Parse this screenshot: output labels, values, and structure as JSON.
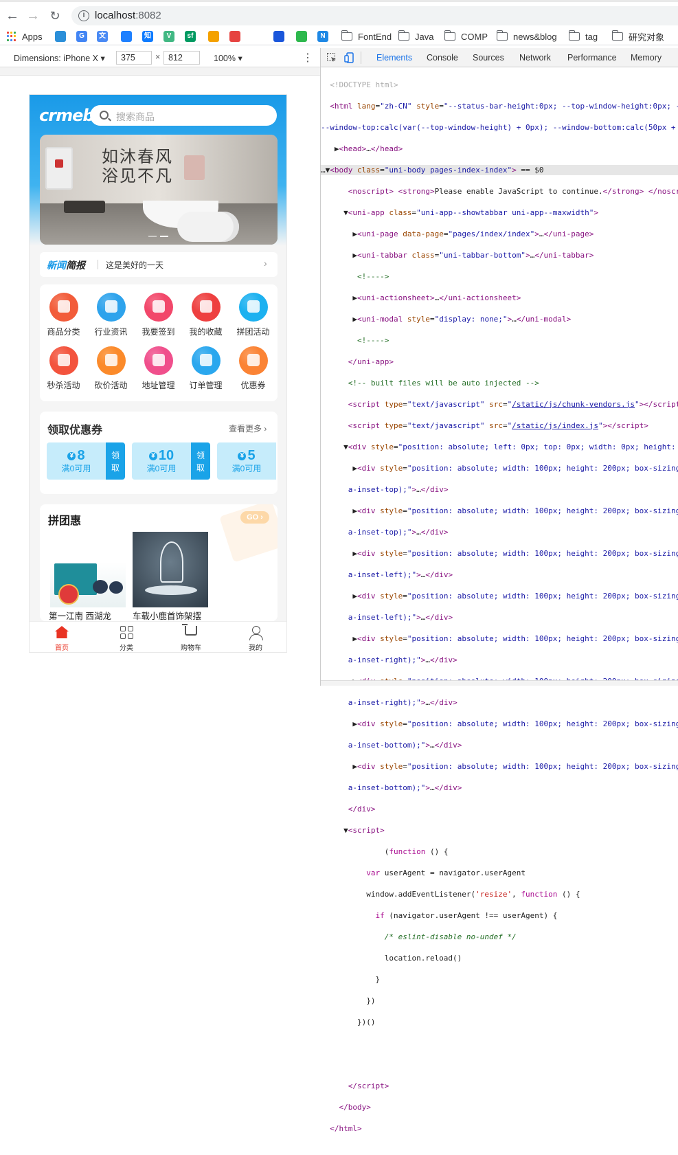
{
  "browser": {
    "url_host": "localhost",
    "url_port": ":8082",
    "bookmarks": [
      {
        "label": "Apps",
        "type": "apps"
      },
      {
        "label": "",
        "type": "site",
        "color": "#2b8fd9"
      },
      {
        "label": "",
        "type": "site",
        "color": "#4285f4",
        "glyph": "G"
      },
      {
        "label": "",
        "type": "site",
        "color": "#4a8af4",
        "glyph": "文"
      },
      {
        "label": "",
        "type": "site",
        "color": "#1e80ff"
      },
      {
        "label": "",
        "type": "site",
        "color": "#0e7bff",
        "glyph": "知"
      },
      {
        "label": "",
        "type": "site",
        "color": "#41b883",
        "glyph": "V"
      },
      {
        "label": "",
        "type": "site",
        "color": "#009a61",
        "glyph": "sf"
      },
      {
        "label": "",
        "type": "site",
        "color": "#f4a100"
      },
      {
        "label": "",
        "type": "site",
        "color": "#e64340"
      },
      {
        "label": "",
        "type": "site",
        "color": "#1a56db"
      },
      {
        "label": "",
        "type": "site",
        "color": "#2db84d"
      },
      {
        "label": "",
        "type": "site",
        "color": "#1e88e5",
        "glyph": "N"
      },
      {
        "label": "FontEnd",
        "type": "folder"
      },
      {
        "label": "Java",
        "type": "folder"
      },
      {
        "label": "COMP",
        "type": "folder"
      },
      {
        "label": "news&blog",
        "type": "folder"
      },
      {
        "label": "tag",
        "type": "folder"
      },
      {
        "label": "研究对象",
        "type": "folder"
      }
    ]
  },
  "device_toolbar": {
    "device": "Dimensions: iPhone X ▾",
    "width": "375",
    "height": "812",
    "times": "×",
    "zoom": "100% ▾",
    "more": "⋮"
  },
  "page": {
    "logo": "crmeb",
    "search_placeholder": "搜索商品",
    "banner_slogan_1": "如沐春风",
    "banner_slogan_2": "浴见不凡",
    "news_brand_1": "新闻",
    "news_brand_2": "简报",
    "news_text": "这是美好的一天",
    "menu": [
      {
        "label": "商品分类",
        "color": "#f25c3a"
      },
      {
        "label": "行业资讯",
        "color": "#2ea3ec"
      },
      {
        "label": "我要签到",
        "color": "#f2476a"
      },
      {
        "label": "我的收藏",
        "color": "#ee4040"
      },
      {
        "label": "拼团活动",
        "color": "#1cb1f0"
      },
      {
        "label": "秒杀活动",
        "color": "#f3533d"
      },
      {
        "label": "砍价活动",
        "color": "#fb8a2a"
      },
      {
        "label": "地址管理",
        "color": "#f04f8c"
      },
      {
        "label": "订单管理",
        "color": "#2aa7ee"
      },
      {
        "label": "优惠券",
        "color": "#fb8334"
      }
    ],
    "coupons_title": "领取优惠券",
    "coupons_more": "查看更多",
    "coupons": [
      {
        "yen": "¥",
        "amount": "8",
        "condition": "满0可用",
        "get": "领取"
      },
      {
        "yen": "¥",
        "amount": "10",
        "condition": "满0可用",
        "get": "领取"
      },
      {
        "yen": "¥",
        "amount": "5",
        "condition": "满0可用",
        "get": "领取"
      }
    ],
    "group_title": "拼团惠",
    "group_go": "GO",
    "products": [
      {
        "name": "第一江南 西湖龙"
      },
      {
        "name": "车载小鹿首饰架摆"
      }
    ],
    "tabs": [
      {
        "label": "首页",
        "active": true
      },
      {
        "label": "分类",
        "active": false
      },
      {
        "label": "购物车",
        "active": false
      },
      {
        "label": "我的",
        "active": false
      }
    ]
  },
  "devtools": {
    "tabs": [
      "Elements",
      "Console",
      "Sources",
      "Network",
      "Performance",
      "Memory"
    ],
    "active_tab": "Elements"
  }
}
